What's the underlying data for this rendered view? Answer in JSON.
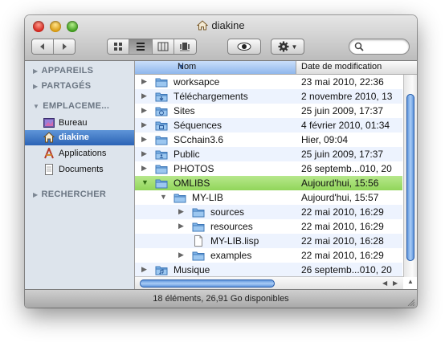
{
  "window": {
    "title": "diakine",
    "title_icon": "home-icon"
  },
  "toolbar": {
    "back_icon": "back-arrow-icon",
    "forward_icon": "forward-arrow-icon",
    "view_modes": [
      "icon-view",
      "list-view",
      "column-view",
      "coverflow-view"
    ],
    "active_view": "list-view",
    "quicklook_icon": "eye-icon",
    "action_icon": "gear-icon",
    "search": {
      "value": "",
      "icon": "search-icon"
    }
  },
  "sidebar": {
    "sections": {
      "devices": "APPAREILS",
      "shared": "PARTAGÉS",
      "places": "EMPLACEME...",
      "search": "RECHERCHER"
    },
    "places": [
      {
        "label": "Bureau",
        "icon": "desktop-icon"
      },
      {
        "label": "diakine",
        "icon": "home-icon",
        "selected": true
      },
      {
        "label": "Applications",
        "icon": "applications-icon"
      },
      {
        "label": "Documents",
        "icon": "documents-icon"
      }
    ]
  },
  "list": {
    "columns": {
      "name": "Nom",
      "date": "Date de modification"
    },
    "rows": [
      {
        "name": "worksapce",
        "date": "23 mai 2010, 22:36",
        "type": "folder",
        "level": 0,
        "expanded": false
      },
      {
        "name": "Téléchargements",
        "date": "2 novembre 2010, 13",
        "type": "downloads-folder",
        "level": 0,
        "expanded": false
      },
      {
        "name": "Sites",
        "date": "25 juin 2009, 17:37",
        "type": "sites-folder",
        "level": 0,
        "expanded": false
      },
      {
        "name": "Séquences",
        "date": "4 février 2010, 01:34",
        "type": "movies-folder",
        "level": 0,
        "expanded": false
      },
      {
        "name": "SCchain3.6",
        "date": "Hier, 09:04",
        "type": "folder",
        "level": 0,
        "expanded": false
      },
      {
        "name": "Public",
        "date": "25 juin 2009, 17:37",
        "type": "public-folder",
        "level": 0,
        "expanded": false
      },
      {
        "name": "PHOTOS",
        "date": "26 septemb...010, 20",
        "type": "folder",
        "level": 0,
        "expanded": false
      },
      {
        "name": "OMLIBS",
        "date": "Aujourd'hui, 15:56",
        "type": "folder",
        "level": 0,
        "expanded": true,
        "selected": true
      },
      {
        "name": "MY-LIB",
        "date": "Aujourd'hui, 15:57",
        "type": "folder",
        "level": 1,
        "expanded": true
      },
      {
        "name": "sources",
        "date": "22 mai 2010, 16:29",
        "type": "folder",
        "level": 2,
        "expanded": false
      },
      {
        "name": "resources",
        "date": "22 mai 2010, 16:29",
        "type": "folder",
        "level": 2,
        "expanded": false
      },
      {
        "name": "MY-LIB.lisp",
        "date": "22 mai 2010, 16:28",
        "type": "file",
        "level": 2,
        "expanded": null
      },
      {
        "name": "examples",
        "date": "22 mai 2010, 16:29",
        "type": "folder",
        "level": 2,
        "expanded": false
      },
      {
        "name": "Musique",
        "date": "26 septemb...010, 20",
        "type": "music-folder",
        "level": 0,
        "expanded": false
      }
    ]
  },
  "status": {
    "text": "18 éléments, 26,91 Go disponibles"
  }
}
